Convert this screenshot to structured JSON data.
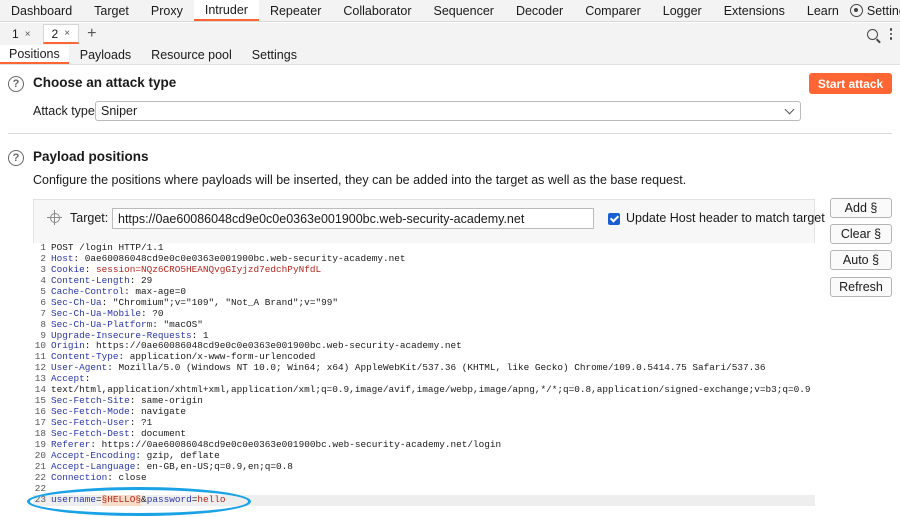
{
  "topbar": {
    "tabs": [
      "Dashboard",
      "Target",
      "Proxy",
      "Intruder",
      "Repeater",
      "Collaborator",
      "Sequencer",
      "Decoder",
      "Comparer",
      "Logger",
      "Extensions",
      "Learn"
    ],
    "active": "Intruder",
    "settings_label": "Settings"
  },
  "attack_tabs": [
    {
      "label": "1",
      "close": "×"
    },
    {
      "label": "2",
      "close": "×"
    }
  ],
  "add_tab": "+",
  "sub_tabs": [
    "Positions",
    "Payloads",
    "Resource pool",
    "Settings"
  ],
  "attack_type": {
    "title": "Choose an attack type",
    "label": "Attack type:",
    "value": "Sniper",
    "start_button": "Start attack"
  },
  "payload_positions": {
    "title": "Payload positions",
    "description": "Configure the positions where payloads will be inserted, they can be added into the target as well as the base request.",
    "target_label": "Target:",
    "target_value": "https://0ae60086048cd9e0c0e0363e001900bc.web-security-academy.net",
    "update_host_label": "Update Host header to match target",
    "update_host_checked": true
  },
  "side_buttons": [
    "Add §",
    "Clear §",
    "Auto §",
    "Refresh"
  ],
  "request": {
    "request_line": "POST /login HTTP/1.1",
    "headers": [
      {
        "name": "Host",
        "value": "0ae60086048cd9e0c0e0363e001900bc.web-security-academy.net"
      },
      {
        "name": "Cookie",
        "value": "session=NQz6CRO5HEANQvgGIyjzd7edchPyNfdL"
      },
      {
        "name": "Content-Length",
        "value": "29"
      },
      {
        "name": "Cache-Control",
        "value": "max-age=0"
      },
      {
        "name": "Sec-Ch-Ua",
        "value": "\"Chromium\";v=\"109\", \"Not_A Brand\";v=\"99\""
      },
      {
        "name": "Sec-Ch-Ua-Mobile",
        "value": "?0"
      },
      {
        "name": "Sec-Ch-Ua-Platform",
        "value": "\"macOS\""
      },
      {
        "name": "Upgrade-Insecure-Requests",
        "value": "1"
      },
      {
        "name": "Origin",
        "value": "https://0ae60086048cd9e0c0e0363e001900bc.web-security-academy.net"
      },
      {
        "name": "Content-Type",
        "value": "application/x-www-form-urlencoded"
      },
      {
        "name": "User-Agent",
        "value": "Mozilla/5.0 (Windows NT 10.0; Win64; x64) AppleWebKit/537.36 (KHTML, like Gecko) Chrome/109.0.5414.75 Safari/537.36"
      },
      {
        "name": "Accept",
        "value": ""
      },
      {
        "name": "",
        "value": "text/html,application/xhtml+xml,application/xml;q=0.9,image/avif,image/webp,image/apng,*/*;q=0.8,application/signed-exchange;v=b3;q=0.9"
      },
      {
        "name": "Sec-Fetch-Site",
        "value": "same-origin"
      },
      {
        "name": "Sec-Fetch-Mode",
        "value": "navigate"
      },
      {
        "name": "Sec-Fetch-User",
        "value": "?1"
      },
      {
        "name": "Sec-Fetch-Dest",
        "value": "document"
      },
      {
        "name": "Referer",
        "value": "https://0ae60086048cd9e0c0e0363e001900bc.web-security-academy.net/login"
      },
      {
        "name": "Accept-Encoding",
        "value": "gzip, deflate"
      },
      {
        "name": "Accept-Language",
        "value": "en-GB,en-US;q=0.9,en;q=0.8"
      },
      {
        "name": "Connection",
        "value": "close"
      }
    ],
    "body": {
      "username_key": "username",
      "payload_marker": "§HELLO§",
      "password_key": "password",
      "password_value": "hello"
    }
  },
  "colors": {
    "accent": "#ff6633",
    "highlight_ellipse": "#1aa2e6",
    "header_key": "#2b37a8",
    "value_red": "#b3261e"
  }
}
